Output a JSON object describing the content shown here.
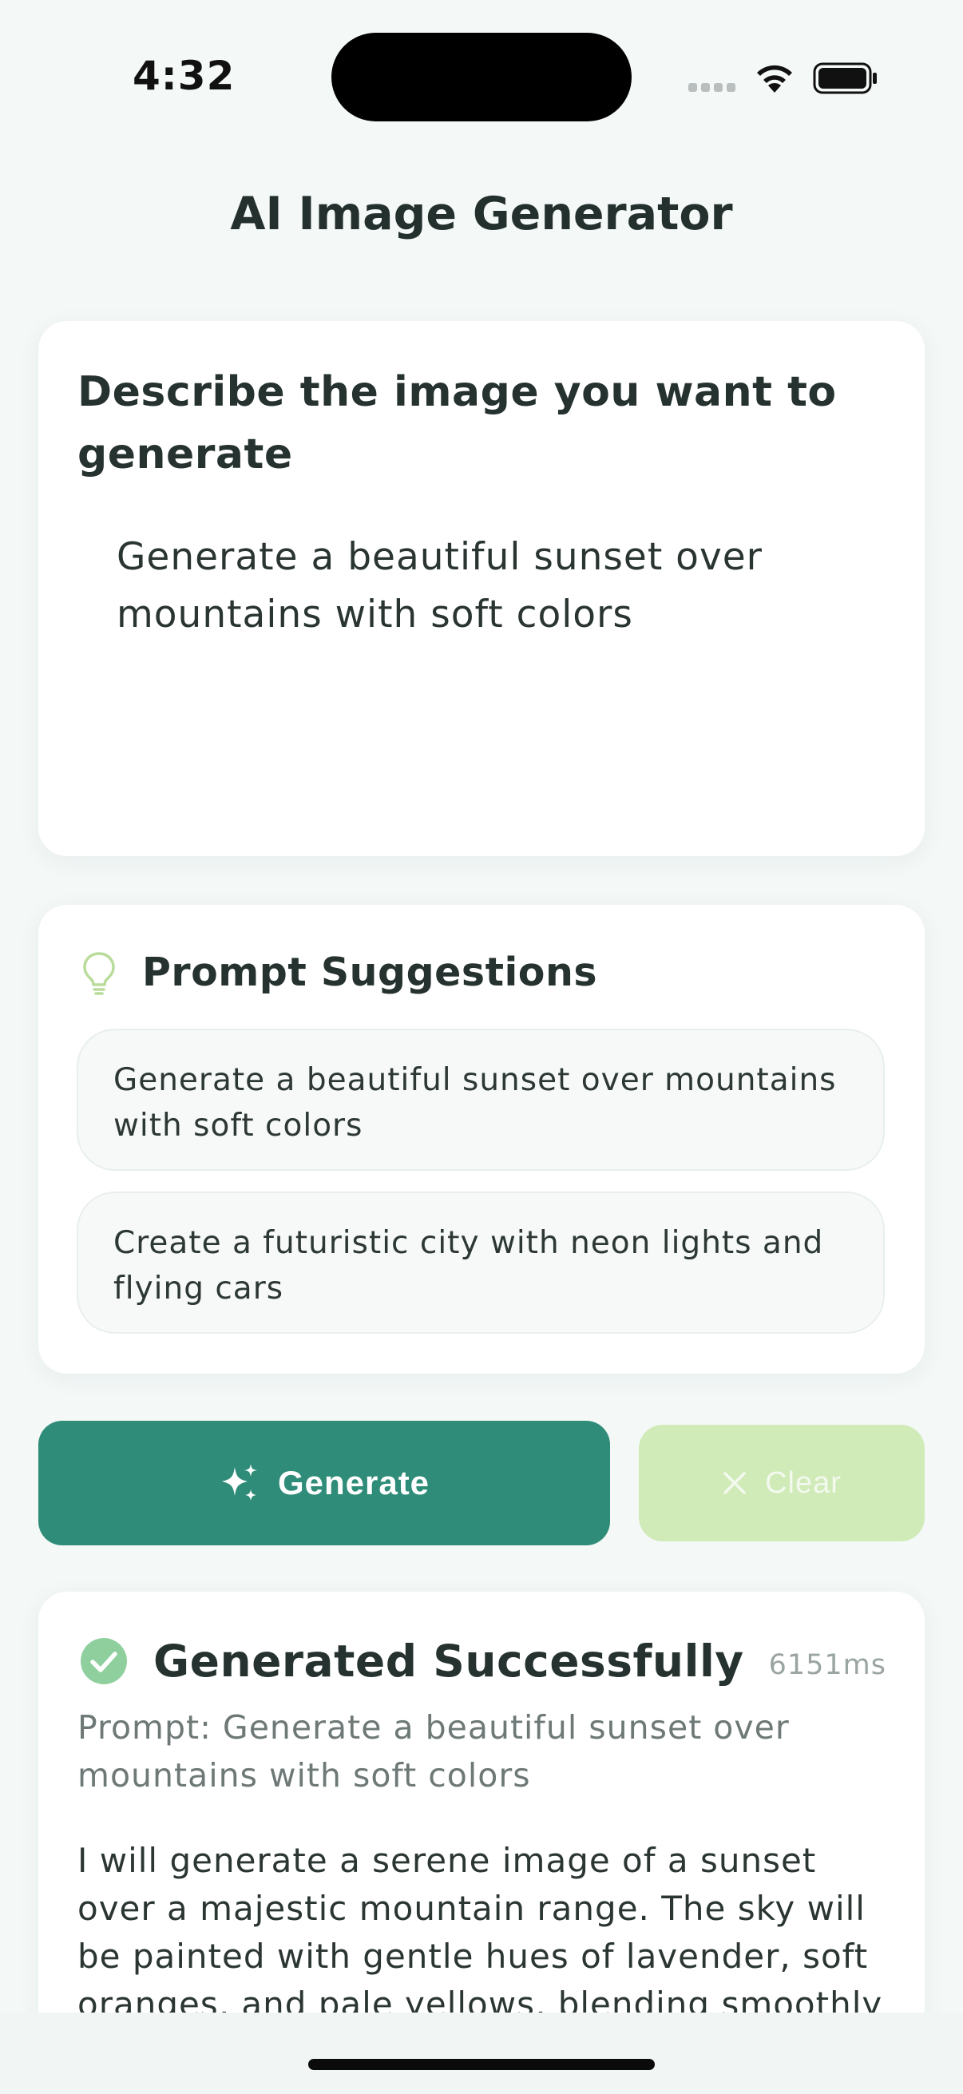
{
  "status_bar": {
    "time": "4:32"
  },
  "app": {
    "title": "AI Image Generator"
  },
  "prompt_card": {
    "heading": "Describe the image you want to generate",
    "input_value": "Generate a beautiful sunset over mountains with soft colors"
  },
  "suggestions": {
    "title": "Prompt Suggestions",
    "items": [
      {
        "text": "Generate a beautiful sunset over mountains with soft colors"
      },
      {
        "text": "Create a futuristic city with neon lights and flying cars"
      }
    ]
  },
  "actions": {
    "generate_label": "Generate",
    "clear_label": "Clear"
  },
  "result": {
    "status_title": "Generated Successfully",
    "duration": "6151ms",
    "prompt_line": "Prompt: Generate a beautiful sunset over mountains with soft colors",
    "description": "I will generate a serene image of a sunset over a majestic mountain range. The sky will be painted with gentle hues of lavender, soft oranges, and pale yellows, blending smoothly into one another"
  },
  "colors": {
    "accent": "#2e8c78",
    "clear_button": "#d0ebb8",
    "success": "#8fcf9e",
    "background": "#f4f8f7"
  }
}
